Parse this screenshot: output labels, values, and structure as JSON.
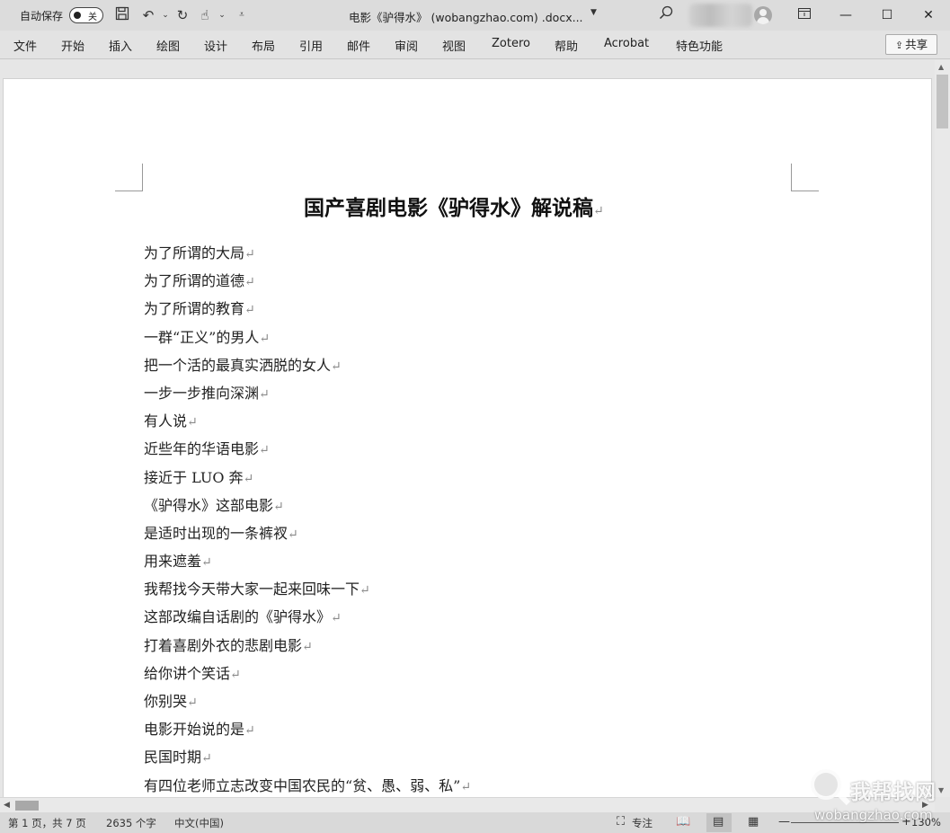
{
  "titlebar": {
    "autosave_label": "自动保存",
    "autosave_state": "关",
    "document_title": "电影《驴得水》 (wobangzhao.com) .docx...",
    "icons": [
      "save-icon",
      "undo-icon",
      "redo-icon",
      "touch-mode-icon",
      "customize-icon"
    ]
  },
  "ribbon": {
    "tabs": [
      "文件",
      "开始",
      "插入",
      "绘图",
      "设计",
      "布局",
      "引用",
      "邮件",
      "审阅",
      "视图",
      "Zotero",
      "帮助",
      "Acrobat",
      "特色功能"
    ],
    "share_label": "共享"
  },
  "document": {
    "heading": "国产喜剧电影《驴得水》解说稿",
    "paragraph_mark": "↵",
    "lines": [
      "为了所谓的大局",
      "为了所谓的道德",
      "为了所谓的教育",
      "一群“正义”的男人",
      "把一个活的最真实洒脱的女人",
      "一步一步推向深渊",
      "有人说",
      "近些年的华语电影",
      "接近于 LUO 奔",
      "《驴得水》这部电影",
      "是适时出现的一条裤衩",
      "用来遮羞",
      "我帮找今天带大家一起来回味一下",
      "这部改编自话剧的《驴得水》",
      "打着喜剧外衣的悲剧电影",
      "给你讲个笑话",
      "你别哭",
      "电影开始说的是",
      "民国时期",
      "有四位老师立志改变中国农民的“贫、愚、弱、私”"
    ]
  },
  "statusbar": {
    "page_info": "第 1 页，共 7 页",
    "word_count": "2635 个字",
    "language": "中文(中国)",
    "focus_label": "专注",
    "zoom": "130%"
  },
  "watermark": {
    "brand": "我帮找网",
    "url": "wobangzhao.com"
  }
}
